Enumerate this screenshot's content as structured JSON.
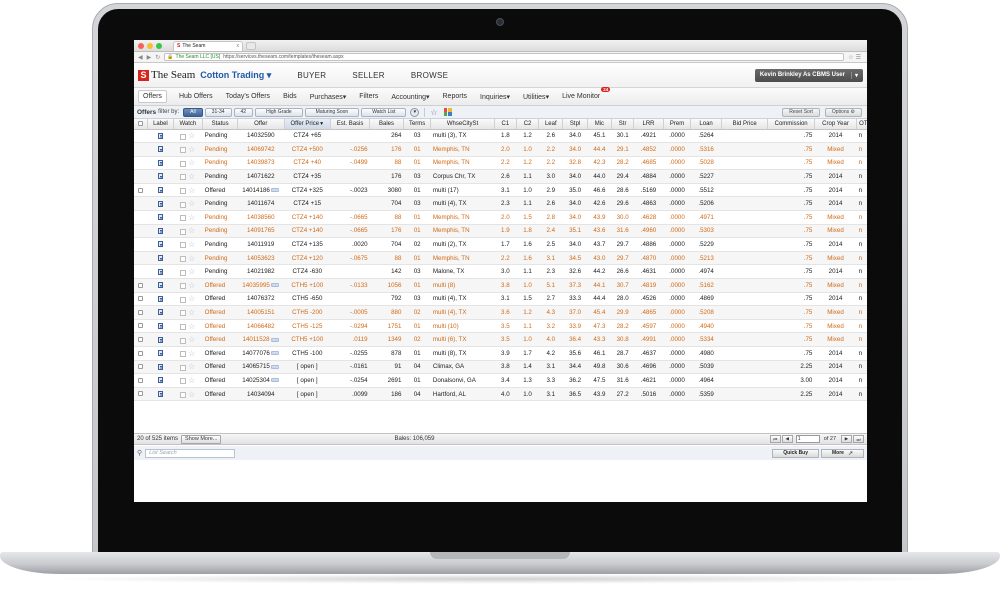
{
  "browser": {
    "tab_title": "The Seam",
    "tab_close": "x",
    "site_badge": "The Seam LLC [US]",
    "url": "https://services.theseam.com/templates/theseam.aspx"
  },
  "header": {
    "logo": "The Seam",
    "logo_mark": "S",
    "module": "Cotton Trading ▾",
    "nav": [
      "BUYER",
      "SELLER",
      "BROWSE"
    ],
    "user": "Kevin Brinkley As CBMS User",
    "user_caret": "▾"
  },
  "subnav": {
    "items": [
      "Offers",
      "Hub Offers",
      "Today's Offers",
      "Bids",
      "Purchases",
      "Filters",
      "Accounting",
      "Reports",
      "Inquiries",
      "Utilities",
      "Live Monitor"
    ],
    "caret": "▾",
    "live_monitor_badge": "24"
  },
  "filter": {
    "label": "Offers",
    "sublabel": "filter by:",
    "chips": [
      "All",
      "31-34",
      "42",
      "High Grade",
      "Maturing Soon",
      "Watch List"
    ],
    "reset": "Reset Sort",
    "options": "Options"
  },
  "table": {
    "columns": [
      "",
      "Label",
      "Watch",
      "Status",
      "Offer",
      "Offer Price",
      "Est. Basis",
      "Bales",
      "Terms",
      "WhseCitySt",
      "C1",
      "C2",
      "Leaf",
      "Stpl",
      "Mic",
      "Str",
      "LRR",
      "Prem",
      "Loan",
      "Bid Price",
      "Commission",
      "Crop Year",
      "OTH"
    ],
    "new_badge": "new",
    "rows": [
      {
        "cb": false,
        "status": "Pending",
        "offer": "14032590",
        "new": false,
        "price": "CTZ4 +65",
        "basis": "",
        "bales": "264",
        "terms": "03",
        "whse": "multi (3), TX",
        "c1": "1.8",
        "c2": "1.2",
        "leaf": "2.6",
        "stpl": "34.0",
        "mic": "45.1",
        "str": "30.1",
        "lrr": ".4921",
        "prem": ".0000",
        "loan": ".5264",
        "bid": "",
        "comm": ".75",
        "crop": "2014",
        "oth": "n",
        "orange": false
      },
      {
        "cb": false,
        "status": "Pending",
        "offer": "14069742",
        "new": false,
        "price": "CTZ4 +500",
        "basis": "-.0256",
        "bales": "176",
        "terms": "01",
        "whse": "Memphis, TN",
        "c1": "2.0",
        "c2": "1.0",
        "leaf": "2.2",
        "stpl": "34.0",
        "mic": "44.4",
        "str": "29.1",
        "lrr": ".4852",
        "prem": ".0000",
        "loan": ".5316",
        "bid": "",
        "comm": ".75",
        "crop": "Mixed",
        "oth": "n",
        "orange": true
      },
      {
        "cb": false,
        "status": "Pending",
        "offer": "14039873",
        "new": false,
        "price": "CTZ4 +40",
        "basis": "-.0499",
        "bales": "88",
        "terms": "01",
        "whse": "Memphis, TN",
        "c1": "2.2",
        "c2": "1.2",
        "leaf": "2.2",
        "stpl": "32.8",
        "mic": "42.3",
        "str": "28.2",
        "lrr": ".4685",
        "prem": ".0000",
        "loan": ".5028",
        "bid": "",
        "comm": ".75",
        "crop": "Mixed",
        "oth": "n",
        "orange": true
      },
      {
        "cb": false,
        "status": "Pending",
        "offer": "14071622",
        "new": false,
        "price": "CTZ4 +35",
        "basis": "",
        "bales": "176",
        "terms": "03",
        "whse": "Corpus Chr, TX",
        "c1": "2.6",
        "c2": "1.1",
        "leaf": "3.0",
        "stpl": "34.0",
        "mic": "44.0",
        "str": "29.4",
        "lrr": ".4884",
        "prem": ".0000",
        "loan": ".5227",
        "bid": "",
        "comm": ".75",
        "crop": "2014",
        "oth": "n",
        "orange": false
      },
      {
        "cb": true,
        "status": "Offered",
        "offer": "14014186",
        "new": true,
        "price": "CTZ4 +325",
        "basis": "-.0023",
        "bales": "3080",
        "terms": "01",
        "whse": "multi (17)",
        "c1": "3.1",
        "c2": "1.0",
        "leaf": "2.9",
        "stpl": "35.0",
        "mic": "46.6",
        "str": "28.6",
        "lrr": ".5169",
        "prem": ".0000",
        "loan": ".5512",
        "bid": "",
        "comm": ".75",
        "crop": "2014",
        "oth": "n",
        "orange": false
      },
      {
        "cb": false,
        "status": "Pending",
        "offer": "14011674",
        "new": false,
        "price": "CTZ4 +15",
        "basis": "",
        "bales": "704",
        "terms": "03",
        "whse": "multi (4), TX",
        "c1": "2.3",
        "c2": "1.1",
        "leaf": "2.6",
        "stpl": "34.0",
        "mic": "42.6",
        "str": "29.6",
        "lrr": ".4863",
        "prem": ".0000",
        "loan": ".5206",
        "bid": "",
        "comm": ".75",
        "crop": "2014",
        "oth": "n",
        "orange": false
      },
      {
        "cb": false,
        "status": "Pending",
        "offer": "14038560",
        "new": false,
        "price": "CTZ4 +140",
        "basis": "-.0665",
        "bales": "88",
        "terms": "01",
        "whse": "Memphis, TN",
        "c1": "2.0",
        "c2": "1.5",
        "leaf": "2.8",
        "stpl": "34.0",
        "mic": "43.9",
        "str": "30.0",
        "lrr": ".4628",
        "prem": ".0000",
        "loan": ".4971",
        "bid": "",
        "comm": ".75",
        "crop": "Mixed",
        "oth": "n",
        "orange": true
      },
      {
        "cb": false,
        "status": "Pending",
        "offer": "14091765",
        "new": false,
        "price": "CTZ4 +140",
        "basis": "-.0665",
        "bales": "176",
        "terms": "01",
        "whse": "Memphis, TN",
        "c1": "1.9",
        "c2": "1.8",
        "leaf": "2.4",
        "stpl": "35.1",
        "mic": "43.6",
        "str": "31.6",
        "lrr": ".4960",
        "prem": ".0000",
        "loan": ".5303",
        "bid": "",
        "comm": ".75",
        "crop": "Mixed",
        "oth": "n",
        "orange": true
      },
      {
        "cb": false,
        "status": "Pending",
        "offer": "14011919",
        "new": false,
        "price": "CTZ4 +135",
        "basis": ".0020",
        "bales": "704",
        "terms": "02",
        "whse": "multi (2), TX",
        "c1": "1.7",
        "c2": "1.6",
        "leaf": "2.5",
        "stpl": "34.0",
        "mic": "43.7",
        "str": "29.7",
        "lrr": ".4886",
        "prem": ".0000",
        "loan": ".5229",
        "bid": "",
        "comm": ".75",
        "crop": "2014",
        "oth": "n",
        "orange": false
      },
      {
        "cb": false,
        "status": "Pending",
        "offer": "14053623",
        "new": false,
        "price": "CTZ4 +120",
        "basis": "-.0675",
        "bales": "88",
        "terms": "01",
        "whse": "Memphis, TN",
        "c1": "2.2",
        "c2": "1.6",
        "leaf": "3.1",
        "stpl": "34.5",
        "mic": "43.0",
        "str": "29.7",
        "lrr": ".4870",
        "prem": ".0000",
        "loan": ".5213",
        "bid": "",
        "comm": ".75",
        "crop": "Mixed",
        "oth": "n",
        "orange": true
      },
      {
        "cb": false,
        "status": "Pending",
        "offer": "14021982",
        "new": false,
        "price": "CTZ4 -630",
        "basis": "",
        "bales": "142",
        "terms": "03",
        "whse": "Malone, TX",
        "c1": "3.0",
        "c2": "1.1",
        "leaf": "2.3",
        "stpl": "32.6",
        "mic": "44.2",
        "str": "26.6",
        "lrr": ".4631",
        "prem": ".0000",
        "loan": ".4974",
        "bid": "",
        "comm": ".75",
        "crop": "2014",
        "oth": "n",
        "orange": false
      },
      {
        "cb": true,
        "status": "Offered",
        "offer": "14035995",
        "new": true,
        "price": "CTH5 +100",
        "basis": "-.0133",
        "bales": "1056",
        "terms": "01",
        "whse": "multi (8)",
        "c1": "3.8",
        "c2": "1.0",
        "leaf": "5.1",
        "stpl": "37.3",
        "mic": "44.1",
        "str": "30.7",
        "lrr": ".4819",
        "prem": ".0000",
        "loan": ".5162",
        "bid": "",
        "comm": ".75",
        "crop": "Mixed",
        "oth": "n",
        "orange": true
      },
      {
        "cb": true,
        "status": "Offered",
        "offer": "14076372",
        "new": false,
        "price": "CTH5 -650",
        "basis": "",
        "bales": "792",
        "terms": "03",
        "whse": "multi (4), TX",
        "c1": "3.1",
        "c2": "1.5",
        "leaf": "2.7",
        "stpl": "33.3",
        "mic": "44.4",
        "str": "28.0",
        "lrr": ".4526",
        "prem": ".0000",
        "loan": ".4869",
        "bid": "",
        "comm": ".75",
        "crop": "2014",
        "oth": "n",
        "orange": false
      },
      {
        "cb": true,
        "status": "Offered",
        "offer": "14005151",
        "new": false,
        "price": "CTH5 -200",
        "basis": "-.0005",
        "bales": "880",
        "terms": "02",
        "whse": "multi (4), TX",
        "c1": "3.6",
        "c2": "1.2",
        "leaf": "4.3",
        "stpl": "37.0",
        "mic": "45.4",
        "str": "29.9",
        "lrr": ".4865",
        "prem": ".0000",
        "loan": ".5208",
        "bid": "",
        "comm": ".75",
        "crop": "Mixed",
        "oth": "n",
        "orange": true
      },
      {
        "cb": true,
        "status": "Offered",
        "offer": "14066482",
        "new": false,
        "price": "CTH5 -125",
        "basis": "-.0294",
        "bales": "1751",
        "terms": "01",
        "whse": "multi (10)",
        "c1": "3.5",
        "c2": "1.1",
        "leaf": "3.2",
        "stpl": "33.9",
        "mic": "47.3",
        "str": "28.2",
        "lrr": ".4597",
        "prem": ".0000",
        "loan": ".4940",
        "bid": "",
        "comm": ".75",
        "crop": "Mixed",
        "oth": "n",
        "orange": true
      },
      {
        "cb": true,
        "status": "Offered",
        "offer": "14011528",
        "new": true,
        "price": "CTH5 +100",
        "basis": ".0119",
        "bales": "1349",
        "terms": "02",
        "whse": "multi (6), TX",
        "c1": "3.5",
        "c2": "1.0",
        "leaf": "4.0",
        "stpl": "36.4",
        "mic": "43.3",
        "str": "30.8",
        "lrr": ".4991",
        "prem": ".0000",
        "loan": ".5334",
        "bid": "",
        "comm": ".75",
        "crop": "Mixed",
        "oth": "n",
        "orange": true
      },
      {
        "cb": true,
        "status": "Offered",
        "offer": "14077076",
        "new": true,
        "price": "CTH5 -100",
        "basis": "-.0255",
        "bales": "878",
        "terms": "01",
        "whse": "multi (8), TX",
        "c1": "3.9",
        "c2": "1.7",
        "leaf": "4.2",
        "stpl": "35.6",
        "mic": "46.1",
        "str": "28.7",
        "lrr": ".4637",
        "prem": ".0000",
        "loan": ".4980",
        "bid": "",
        "comm": ".75",
        "crop": "2014",
        "oth": "n",
        "orange": false
      },
      {
        "cb": true,
        "status": "Offered",
        "offer": "14065715",
        "new": true,
        "price": "[ open ]",
        "basis": "-.0161",
        "bales": "91",
        "terms": "04",
        "whse": "Climax, GA",
        "c1": "3.8",
        "c2": "1.4",
        "leaf": "3.1",
        "stpl": "34.4",
        "mic": "49.8",
        "str": "30.6",
        "lrr": ".4696",
        "prem": ".0000",
        "loan": ".5039",
        "bid": "",
        "comm": "2.25",
        "crop": "2014",
        "oth": "n",
        "orange": false
      },
      {
        "cb": true,
        "status": "Offered",
        "offer": "14025304",
        "new": true,
        "price": "[ open ]",
        "basis": "-.0254",
        "bales": "2691",
        "terms": "01",
        "whse": "Donalsonvi, GA",
        "c1": "3.4",
        "c2": "1.3",
        "leaf": "3.3",
        "stpl": "36.2",
        "mic": "47.5",
        "str": "31.6",
        "lrr": ".4621",
        "prem": ".0000",
        "loan": ".4964",
        "bid": "",
        "comm": "3.00",
        "crop": "2014",
        "oth": "n",
        "orange": false
      },
      {
        "cb": true,
        "status": "Offered",
        "offer": "14034094",
        "new": false,
        "price": "[ open ]",
        "basis": ".0099",
        "bales": "186",
        "terms": "04",
        "whse": "Hartford, AL",
        "c1": "4.0",
        "c2": "1.0",
        "leaf": "3.1",
        "stpl": "36.5",
        "mic": "43.9",
        "str": "27.2",
        "lrr": ".5016",
        "prem": ".0000",
        "loan": ".5359",
        "bid": "",
        "comm": "2.25",
        "crop": "2014",
        "oth": "n",
        "orange": false
      }
    ]
  },
  "footer": {
    "count": "20 of 525 items",
    "show_more": "Show More...",
    "bales_total": "Bales: 106,059",
    "page": "1",
    "page_of": "of 27",
    "search_placeholder": "List Search",
    "quick_buy": "Quick Buy",
    "more": "More"
  },
  "colors": {
    "brand_red": "#d8241c",
    "link_blue": "#1f5aa6",
    "highlight_orange": "#d06a17"
  }
}
